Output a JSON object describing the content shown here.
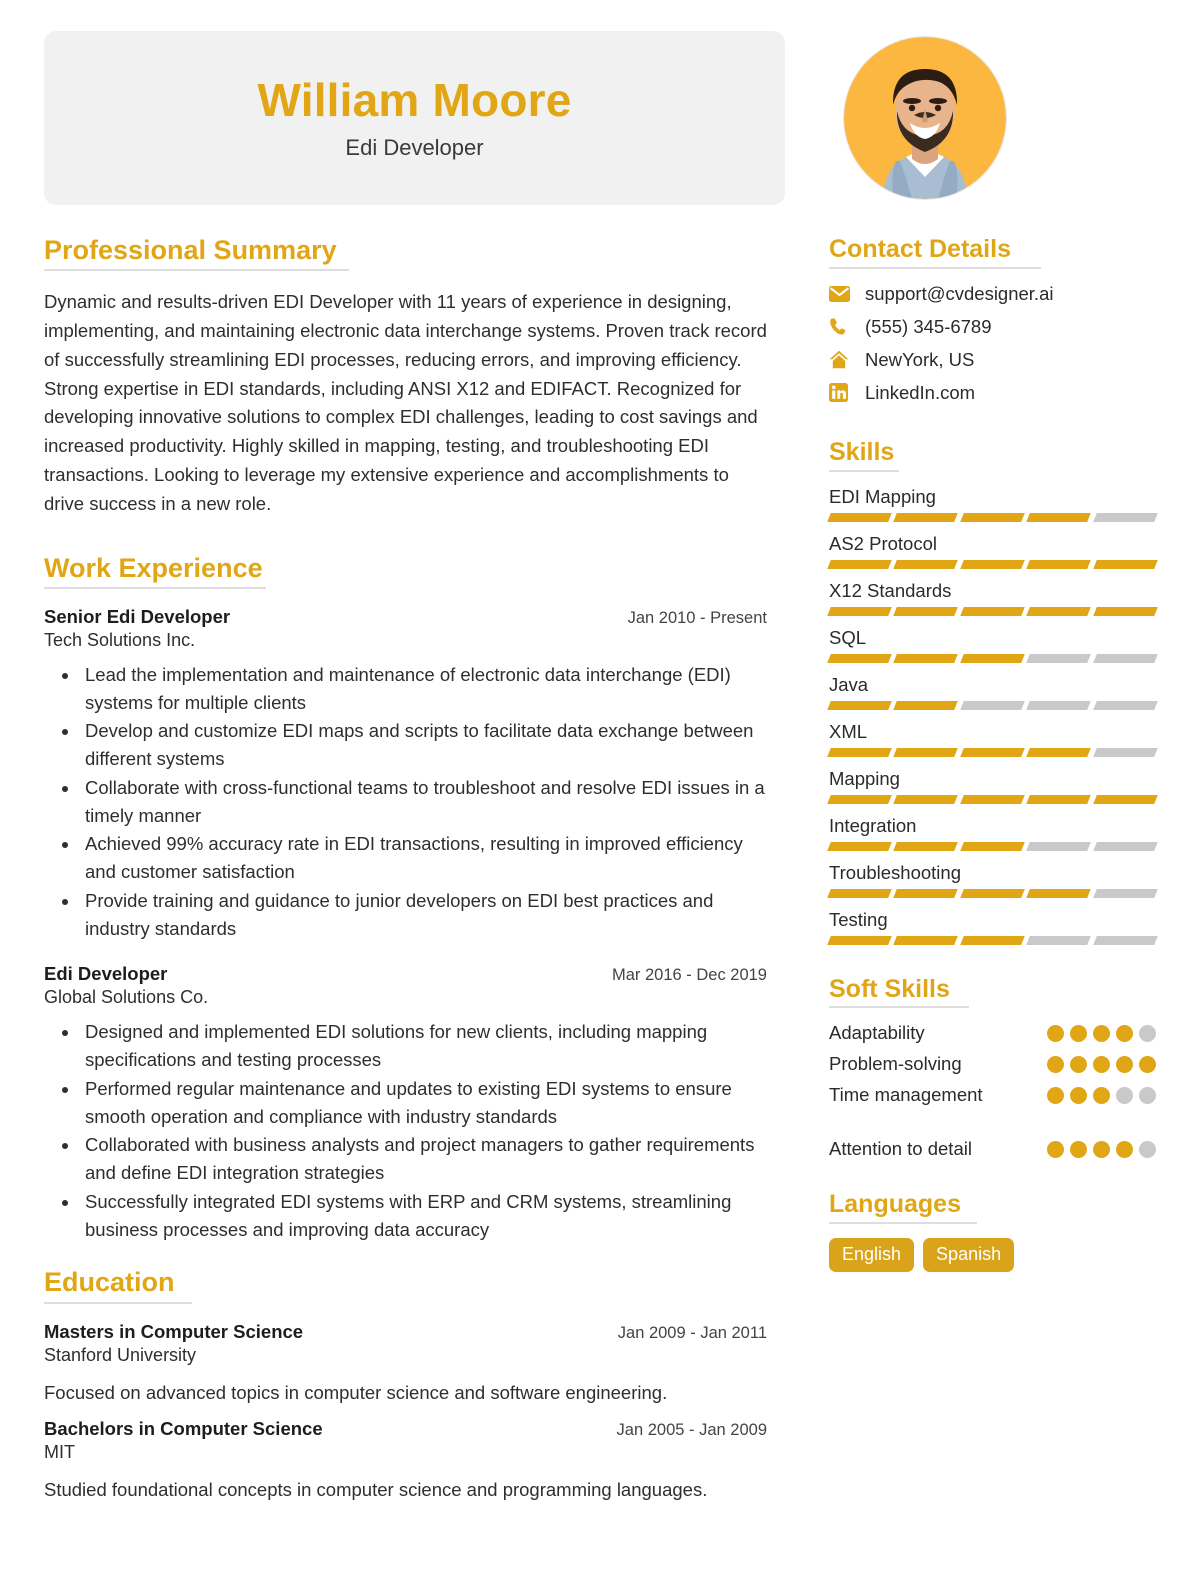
{
  "colors": {
    "accent": "#e0a616",
    "accent_tag": "#d9a31a",
    "header_card_bg": "#f1f1f1",
    "rule": "#dedede",
    "bar_off": "#c9c9c9",
    "text": "#2b2b2b",
    "avatar_bg": "#fbb73f"
  },
  "header": {
    "name": "William Moore",
    "title": "Edi Developer",
    "avatar_alt": "portrait-photo"
  },
  "professional_summary": {
    "heading": "Professional Summary",
    "text": "Dynamic and results-driven EDI Developer with 11 years of experience in designing, implementing, and maintaining electronic data interchange systems. Proven track record of successfully streamlining EDI processes, reducing errors, and improving efficiency. Strong expertise in EDI standards, including ANSI X12 and EDIFACT. Recognized for developing innovative solutions to complex EDI challenges, leading to cost savings and increased productivity. Highly skilled in mapping, testing, and troubleshooting EDI transactions. Looking to leverage my extensive experience and accomplishments to drive success in a new role."
  },
  "work_experience": {
    "heading": "Work Experience",
    "jobs": [
      {
        "title": "Senior Edi Developer",
        "dates": "Jan 2010 - Present",
        "company": "Tech Solutions Inc.",
        "bullets": [
          "Lead the implementation and maintenance of electronic data interchange (EDI) systems for multiple clients",
          "Develop and customize EDI maps and scripts to facilitate data exchange between different systems",
          "Collaborate with cross-functional teams to troubleshoot and resolve EDI issues in a timely manner",
          "Achieved 99% accuracy rate in EDI transactions, resulting in improved efficiency and customer satisfaction",
          "Provide training and guidance to junior developers on EDI best practices and industry standards"
        ]
      },
      {
        "title": "Edi Developer",
        "dates": "Mar 2016 - Dec 2019",
        "company": "Global Solutions Co.",
        "bullets": [
          "Designed and implemented EDI solutions for new clients, including mapping specifications and testing processes",
          "Performed regular maintenance and updates to existing EDI systems to ensure smooth operation and compliance with industry standards",
          "Collaborated with business analysts and project managers to gather requirements and define EDI integration strategies",
          "Successfully integrated EDI systems with ERP and CRM systems, streamlining business processes and improving data accuracy"
        ]
      }
    ]
  },
  "education": {
    "heading": "Education",
    "entries": [
      {
        "degree": "Masters in Computer Science",
        "dates": "Jan 2009 - Jan 2011",
        "school": "Stanford University",
        "description": "Focused on advanced topics in computer science and software engineering."
      },
      {
        "degree": "Bachelors in Computer Science",
        "dates": "Jan 2005 - Jan 2009",
        "school": "MIT",
        "description": "Studied foundational concepts in computer science and programming languages."
      }
    ]
  },
  "contact": {
    "heading": "Contact Details",
    "items": [
      {
        "icon": "envelope-icon",
        "value": "support@cvdesigner.ai"
      },
      {
        "icon": "phone-icon",
        "value": "(555) 345-6789"
      },
      {
        "icon": "home-icon",
        "value": "NewYork, US"
      },
      {
        "icon": "linkedin-icon",
        "value": "LinkedIn.com"
      }
    ]
  },
  "skills": {
    "heading": "Skills",
    "max": 5,
    "items": [
      {
        "name": "EDI Mapping",
        "level": 4
      },
      {
        "name": "AS2 Protocol",
        "level": 5
      },
      {
        "name": "X12 Standards",
        "level": 5
      },
      {
        "name": "SQL",
        "level": 3
      },
      {
        "name": "Java",
        "level": 2
      },
      {
        "name": "XML",
        "level": 4
      },
      {
        "name": "Mapping",
        "level": 5
      },
      {
        "name": "Integration",
        "level": 3
      },
      {
        "name": "Troubleshooting",
        "level": 4
      },
      {
        "name": "Testing",
        "level": 3
      }
    ]
  },
  "soft_skills": {
    "heading": "Soft Skills",
    "max": 5,
    "items": [
      {
        "name": "Adaptability",
        "level": 4,
        "spaced": false
      },
      {
        "name": "Problem-solving",
        "level": 5,
        "spaced": false
      },
      {
        "name": "Time management",
        "level": 3,
        "spaced": false
      },
      {
        "name": "Attention to detail",
        "level": 4,
        "spaced": true
      }
    ]
  },
  "languages": {
    "heading": "Languages",
    "items": [
      "English",
      "Spanish"
    ]
  }
}
